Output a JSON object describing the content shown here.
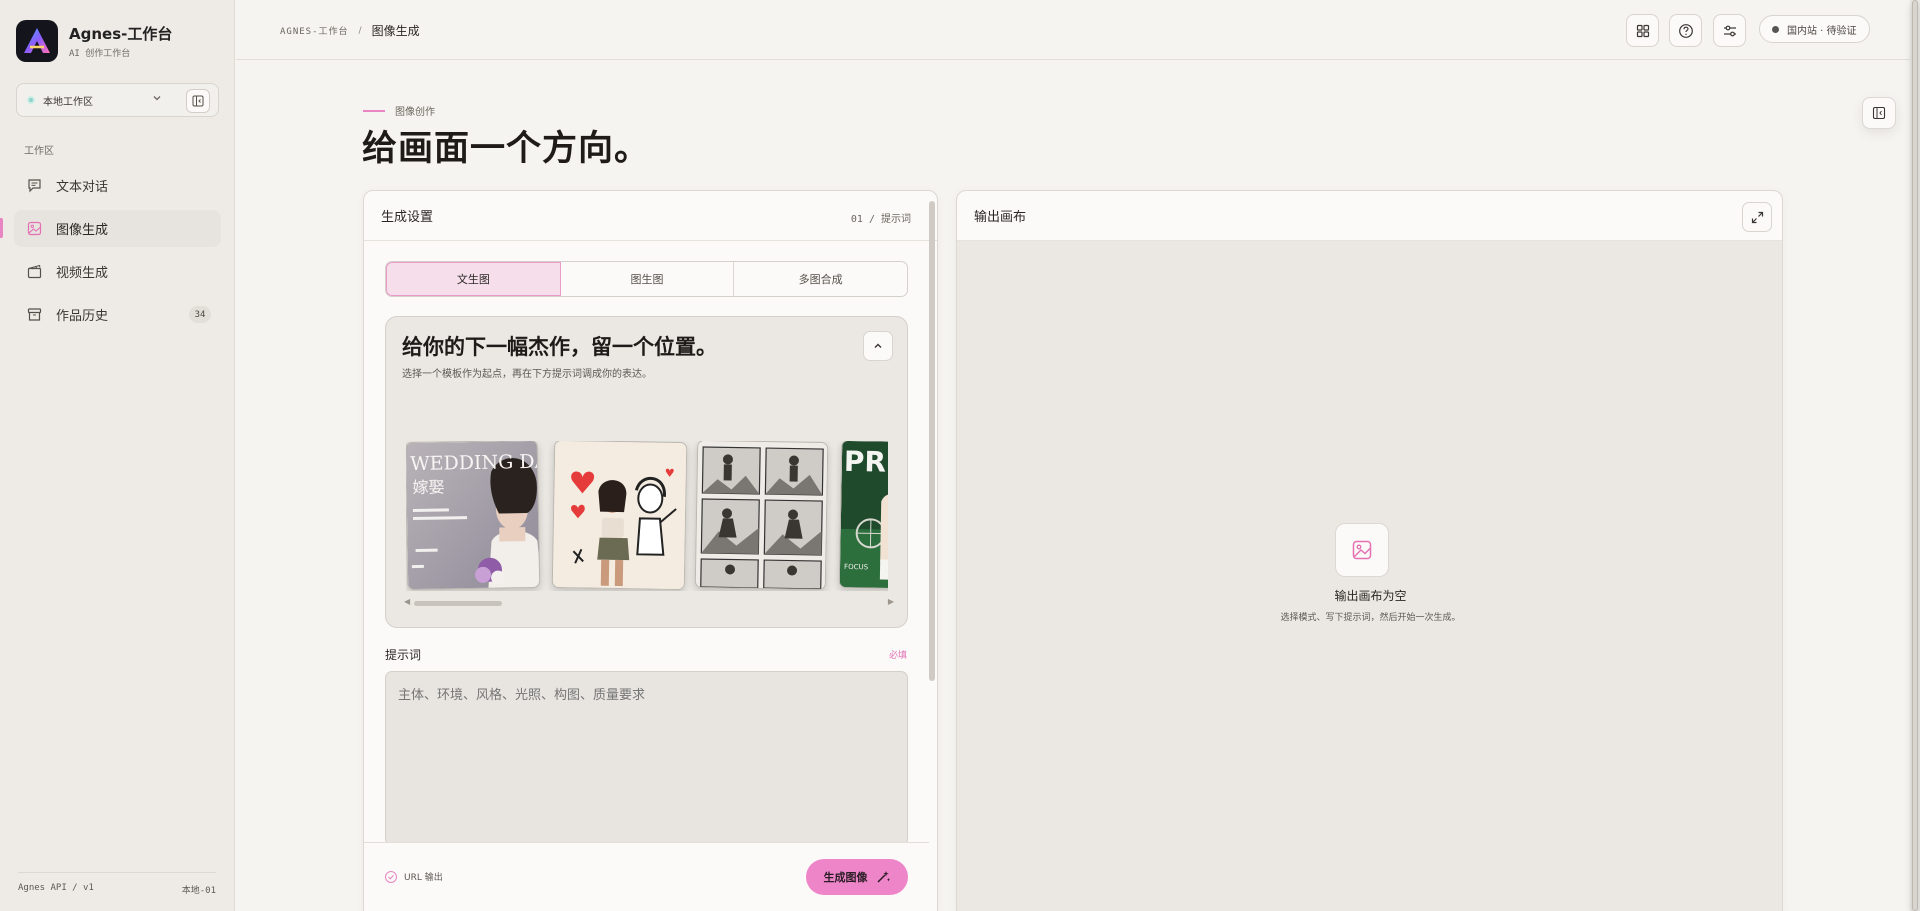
{
  "brand": {
    "name": "Agnes-工作台",
    "subtitle": "AI 创作工作台"
  },
  "workspace": {
    "label": "本地工作区",
    "status_color": "#8ed3c6"
  },
  "sidebar": {
    "section_label": "工作区",
    "items": [
      {
        "label": "文本对话",
        "icon": "chat-icon"
      },
      {
        "label": "图像生成",
        "icon": "image-icon",
        "active": true
      },
      {
        "label": "视频生成",
        "icon": "video-icon"
      },
      {
        "label": "作品历史",
        "icon": "archive-icon",
        "badge": "34"
      }
    ],
    "footer_left": "Agnes API / v1",
    "footer_right": "本地-01"
  },
  "topbar": {
    "breadcrumb_root": "AGNES-工作台",
    "breadcrumb_sep": "/",
    "breadcrumb_current": "图像生成",
    "status": "国内站 · 待验证",
    "buttons": [
      "grid-icon",
      "help-icon",
      "sliders-icon"
    ]
  },
  "hero": {
    "eyebrow": "图像创作",
    "title": "给画面一个方向。"
  },
  "settings": {
    "title": "生成设置",
    "step": "01 / 提示词",
    "tabs": [
      "文生图",
      "图生图",
      "多图合成"
    ],
    "active_tab": 0,
    "templates": {
      "title": "给你的下一幅杰作，留一个位置。",
      "subtitle": "选择一个模板作为起点，再在下方提示词调成你的表达。",
      "thumb1_title": "WEDDING DA",
      "thumb1_sub": "嫁娶",
      "thumb4_title": "PRE",
      "thumb4_sub": "FOCUS"
    },
    "prompt": {
      "label": "提示词",
      "required": "必填",
      "placeholder": "主体、环境、风格、光照、构图、质量要求"
    },
    "url_output": "URL 输出",
    "generate_label": "生成图像"
  },
  "output": {
    "title": "输出画布",
    "empty_title": "输出画布为空",
    "empty_sub": "选择模式、写下提示词，然后开始一次生成。"
  },
  "colors": {
    "accent": "#ee85c8",
    "accent_light": "#f6dfeb",
    "background": "#f6f4f0",
    "sidebar": "#eeebe6"
  }
}
